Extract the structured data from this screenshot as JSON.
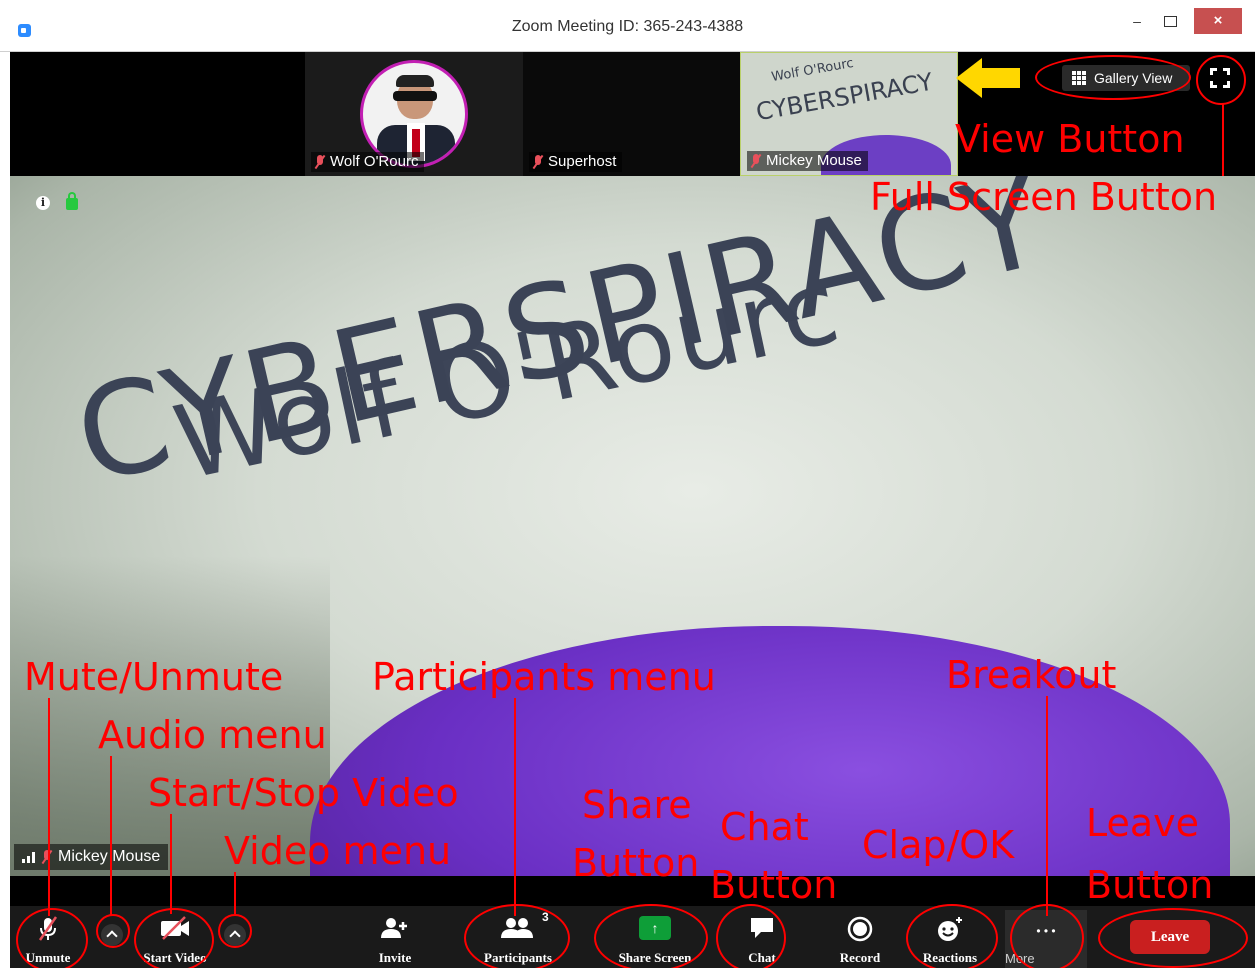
{
  "window": {
    "title": "Zoom Meeting ID: 365-243-4388",
    "minimize": "–",
    "close": "×"
  },
  "thumbnails": [
    {
      "name": "Wolf O'Rourc"
    },
    {
      "name": "Superhost"
    },
    {
      "name": "Mickey Mouse",
      "sign_line1": "Wolf O'Rourc",
      "sign_line2": "CYBERSPIRACY"
    }
  ],
  "view_button": {
    "label": "Gallery View",
    "icon": "grid-icon"
  },
  "main_video": {
    "sign_line1": "Wolf O'Rourc",
    "sign_line2": "CYBERSPIRACY",
    "speaker_name": "Mickey Mouse",
    "info_glyph": "i"
  },
  "toolbar": {
    "unmute": "Unmute",
    "start_video": "Start Video",
    "invite": "Invite",
    "participants": "Participants",
    "participants_count": "3",
    "share_screen": "Share Screen",
    "share_glyph": "↑",
    "chat": "Chat",
    "record": "Record",
    "reactions": "Reactions",
    "more": "More",
    "more_glyph": "• • •",
    "leave": "Leave"
  },
  "annotations": {
    "view_button": "View Button",
    "full_screen_button": "Full Screen Button",
    "mute_unmute": "Mute/Unmute",
    "audio_menu": "Audio menu",
    "start_stop_video": "Start/Stop Video",
    "video_menu": "Video menu",
    "participants_menu": "Participants menu",
    "share_button_1": "Share",
    "share_button_2": "Button",
    "chat_button_1": "Chat",
    "chat_button_2": "Button",
    "clap_ok": "Clap/OK",
    "breakout": "Breakout",
    "leave_button_1": "Leave",
    "leave_button_2": "Button"
  },
  "colors": {
    "annotation": "#ff0000",
    "mute_icon": "#e8505b",
    "share_green": "#0e9e38",
    "leave_red": "#c91f1f",
    "avatar_ring": "#c21fb3",
    "arrow": "#ffd700"
  }
}
